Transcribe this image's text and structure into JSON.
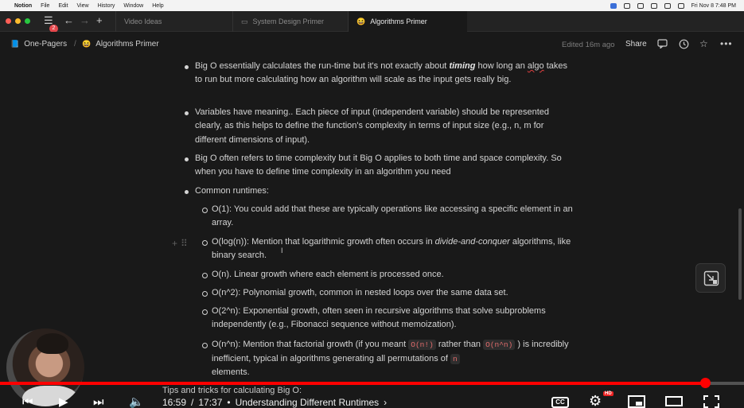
{
  "menubar": {
    "app": "Notion",
    "items": [
      "File",
      "Edit",
      "View",
      "History",
      "Window",
      "Help"
    ],
    "datetime": "Fri Nov 8  7:48 PM"
  },
  "tabbar": {
    "badge": "2",
    "tabs": [
      {
        "label": "Video Ideas",
        "icon": "page-icon"
      },
      {
        "label": "System Design Primer",
        "icon": "monitor-icon"
      },
      {
        "label": "Algorithms Primer",
        "icon": "grin-emoji-icon"
      }
    ]
  },
  "header": {
    "breadcrumb_parent": "One-Pagers",
    "breadcrumb_separator": "/",
    "breadcrumb_current": "Algorithms Primer",
    "edited": "Edited 16m ago",
    "share": "Share"
  },
  "content": {
    "b1_pre": "Big O essentially calculates the run-time but it's not exactly about ",
    "b1_bold": "timing",
    "b1_mid": " how long an ",
    "b1_squig": "algo",
    "b1_post": " takes to run but more calculating how an algorithm will scale as the input gets really big.",
    "b2": "Variables have meaning.. Each piece of input (independent variable) should be represented clearly, as this helps to define the function's complexity in terms of input size (e.g., n, m for different dimensions of input).",
    "b3": "Big O often refers to time complexity but it Big O applies to both time and space complexity. So when you have to define time complexity in an algorithm you need",
    "b4": "Common runtimes:",
    "s1": "O(1): You could add that these are typically operations like accessing a specific element in an array.",
    "s2_pre": "O(log(n)): Mention that logarithmic growth often occurs in ",
    "s2_it": "divide-and-conquer",
    "s2_post": " algorithms, like binary search.",
    "s3": "O(n). Linear growth where each element is processed once.",
    "s4": "O(n^2): Polynomial growth, common in nested loops over the same data set.",
    "s5": "O(2^n): Exponential growth, often seen in recursive algorithms that solve subproblems independently (e.g., Fibonacci sequence without memoization).",
    "s6_pre": "O(n^n): Mention that factorial growth (if you meant ",
    "s6_code1": "O(n!)",
    "s6_mid": " rather than ",
    "s6_code2": "O(n^n)",
    "s6_post1": " ) is incredibly inefficient, typical in algorithms generating all permutations of ",
    "s6_code3": "n",
    "s6_post2": "elements."
  },
  "player": {
    "chapter_title": "Tips and tricks for calculating Big O:",
    "time_current": "16:59",
    "time_sep": "/",
    "time_total": "17:37",
    "bullet": "•",
    "chapter_name": "Understanding Different Runtimes",
    "chapter_arrow": "›",
    "progress": 0.948,
    "badge_hd": "HD",
    "cc_label": "CC",
    "accent": "#ff0000"
  }
}
